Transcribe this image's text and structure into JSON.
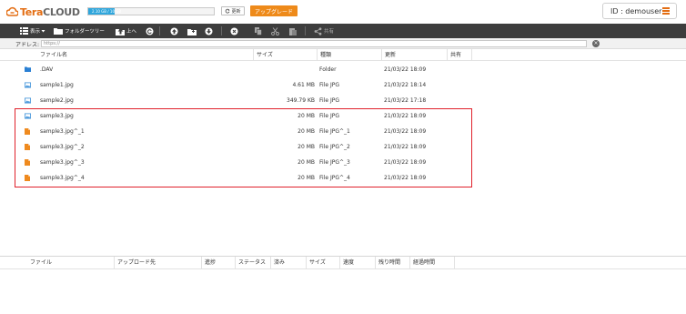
{
  "app": {
    "brand_prefix": "Tera",
    "brand_suffix": "CLOUD",
    "quota_text": "2.10 GB / 10 GB",
    "quota_fraction": 0.21,
    "refresh_label": "更新",
    "upgrade_label": "アップグレード",
    "account_label": "ID : demouser",
    "accent_color": "#ee8a1a",
    "highlight_color": "#e0212b"
  },
  "toolbar": {
    "view_label": "表示",
    "folder_tree_label": "フォルダーツリー",
    "up_label": "上へ",
    "share_label": "共有"
  },
  "address": {
    "label": "アドレス:",
    "value": "https://"
  },
  "file_table": {
    "columns": [
      "ファイル名",
      "サイズ",
      "種類",
      "更新",
      "共有"
    ],
    "rows": [
      {
        "icon": "folder-icon",
        "name": ".DAV",
        "size": "",
        "type": "Folder",
        "modified": "21/03/22 18:09"
      },
      {
        "icon": "image-file-icon",
        "name": "sample1.jpg",
        "size": "4.61 MB",
        "type": "File JPG",
        "modified": "21/03/22 18:14"
      },
      {
        "icon": "image-file-icon",
        "name": "sample2.jpg",
        "size": "349.79 KB",
        "type": "File JPG",
        "modified": "21/03/22 17:18"
      },
      {
        "icon": "image-file-icon",
        "name": "sample3.jpg",
        "size": "20 MB",
        "type": "File JPG",
        "modified": "21/03/22 18:09"
      },
      {
        "icon": "file-icon",
        "name": "sample3.jpg^_1",
        "size": "20 MB",
        "type": "File JPG^_1",
        "modified": "21/03/22 18:09"
      },
      {
        "icon": "file-icon",
        "name": "sample3.jpg^_2",
        "size": "20 MB",
        "type": "File JPG^_2",
        "modified": "21/03/22 18:09"
      },
      {
        "icon": "file-icon",
        "name": "sample3.jpg^_3",
        "size": "20 MB",
        "type": "File JPG^_3",
        "modified": "21/03/22 18:09"
      },
      {
        "icon": "file-icon",
        "name": "sample3.jpg^_4",
        "size": "20 MB",
        "type": "File JPG^_4",
        "modified": "21/03/22 18:09"
      }
    ]
  },
  "upload_table": {
    "columns": [
      "ファイル",
      "アップロード先",
      "進捗",
      "ステータス",
      "済み",
      "サイズ",
      "速度",
      "残り時間",
      "経過時間"
    ]
  }
}
